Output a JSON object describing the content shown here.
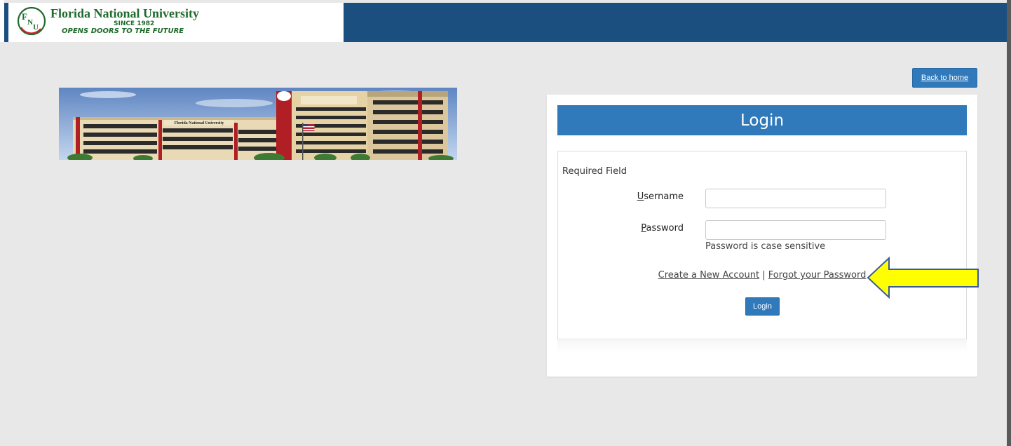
{
  "header": {
    "university_name": "Florida National University",
    "since": "SINCE 1982",
    "tagline": "OPENS DOORS TO THE FUTURE",
    "logo_initials": "FNU",
    "brand_color": "#1b4f80",
    "logo_green": "#1f6b2c"
  },
  "banner": {
    "sign_text": "Florida National University"
  },
  "nav": {
    "back_to_home": "Back to home"
  },
  "login": {
    "title": "Login",
    "required_field": "Required Field",
    "username_label_first": "U",
    "username_label_rest": "sername",
    "password_label_first": "P",
    "password_label_rest": "assword",
    "username_value": "",
    "password_value": "",
    "password_hint": "Password is case sensitive",
    "create_account_link": "Create a New Account",
    "separator": "|",
    "forgot_password_link": "Forgot your Password",
    "submit_label": "Login",
    "accent_color": "#3079ba"
  },
  "annotation": {
    "arrow_color": "#ffff00",
    "arrow_outline": "#3a5c9a",
    "arrow_icon": "left-arrow-icon"
  }
}
